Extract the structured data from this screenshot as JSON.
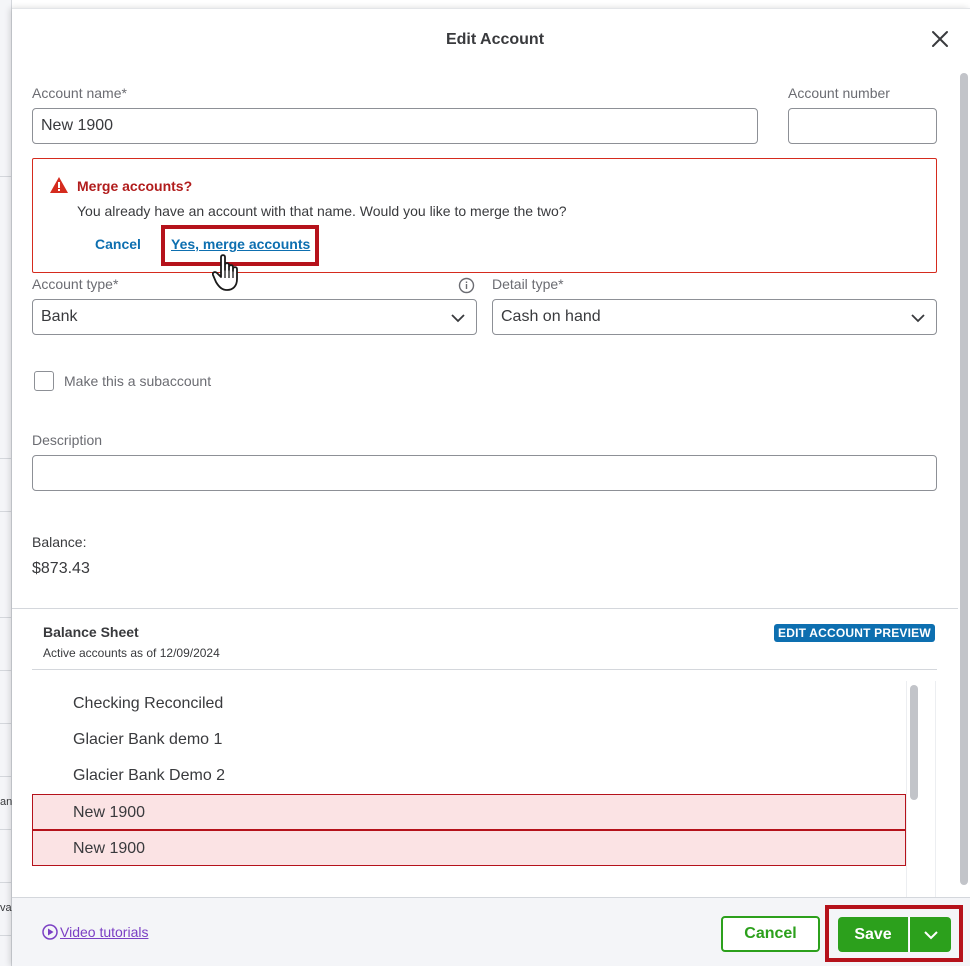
{
  "dialog": {
    "title": "Edit Account"
  },
  "form": {
    "account_name_label": "Account name*",
    "account_name_value": "New 1900",
    "account_number_label": "Account number",
    "account_number_value": "",
    "account_type_label": "Account type*",
    "account_type_value": "Bank",
    "detail_type_label": "Detail type*",
    "detail_type_value": "Cash on hand",
    "subaccount_label": "Make this a subaccount",
    "description_label": "Description",
    "description_value": ""
  },
  "merge": {
    "title": "Merge accounts?",
    "message": "You already have an account with that name. Would you like to merge the two?",
    "cancel_label": "Cancel",
    "confirm_label": "Yes, merge accounts"
  },
  "balance": {
    "label": "Balance:",
    "value": "$873.43"
  },
  "preview": {
    "title": "Balance Sheet",
    "subtitle": "Active accounts as of 12/09/2024",
    "badge": "EDIT ACCOUNT PREVIEW",
    "accounts": [
      {
        "name": "Checking Reconciled",
        "highlighted": false
      },
      {
        "name": "Glacier Bank demo 1",
        "highlighted": false
      },
      {
        "name": "Glacier Bank Demo 2",
        "highlighted": false
      },
      {
        "name": "New 1900",
        "highlighted": true
      },
      {
        "name": "New 1900",
        "highlighted": true
      }
    ]
  },
  "footer": {
    "video_link": "Video tutorials",
    "cancel_label": "Cancel",
    "save_label": "Save"
  },
  "background": {
    "partial_text_1": "an",
    "partial_text_2": "va"
  },
  "colors": {
    "accent_green": "#2ca01c",
    "error_red": "#d52b1e",
    "link_blue": "#0d6fb0",
    "highlight_red": "#b5121b"
  }
}
